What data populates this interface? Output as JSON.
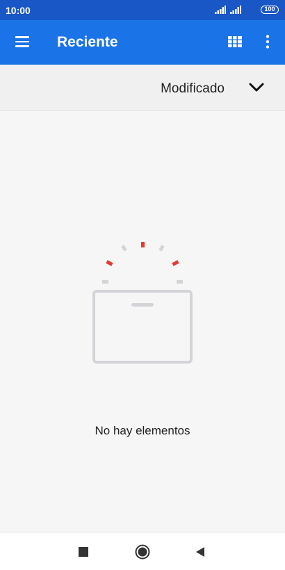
{
  "status_bar": {
    "time": "10:00",
    "battery": "100"
  },
  "app_bar": {
    "title": "Reciente",
    "menu_icon": "hamburger-menu-icon",
    "view_icon": "grid-view-icon",
    "more_icon": "more-vert-icon"
  },
  "sort_bar": {
    "label": "Modificado",
    "icon": "chevron-down-icon"
  },
  "empty_state": {
    "message": "No hay elementos",
    "illustration": "empty-box-icon"
  },
  "nav_bar": {
    "recents_icon": "square-icon",
    "home_icon": "circle-icon",
    "back_icon": "triangle-back-icon"
  },
  "colors": {
    "status_bar": "#1a57c6",
    "app_bar": "#1b73e8",
    "accent_red": "#e53935",
    "illustration_gray": "#d4d4d8"
  }
}
